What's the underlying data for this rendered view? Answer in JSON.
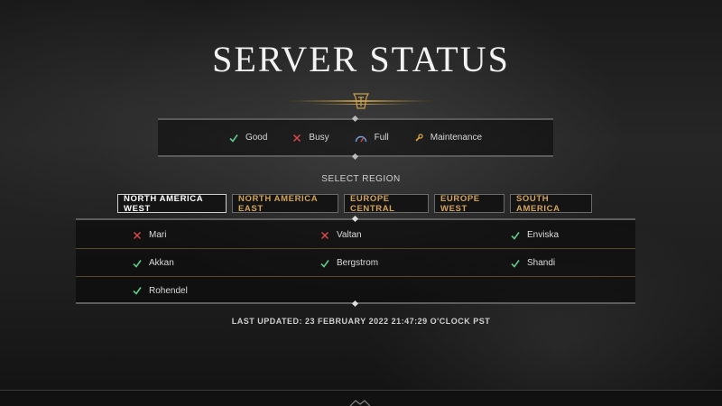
{
  "page": {
    "title": "SERVER STATUS",
    "select_region_label": "SELECT REGION",
    "last_updated": "LAST UPDATED: 23 FEBRUARY 2022 21:47:29 O'CLOCK PST"
  },
  "legend": [
    {
      "icon": "check-icon",
      "label": "Good"
    },
    {
      "icon": "x-icon",
      "label": "Busy"
    },
    {
      "icon": "gauge-icon",
      "label": "Full"
    },
    {
      "icon": "wrench-icon",
      "label": "Maintenance"
    }
  ],
  "tabs": [
    {
      "label": "NORTH AMERICA WEST",
      "active": true
    },
    {
      "label": "NORTH AMERICA EAST",
      "active": false
    },
    {
      "label": "EUROPE CENTRAL",
      "active": false
    },
    {
      "label": "EUROPE WEST",
      "active": false
    },
    {
      "label": "SOUTH AMERICA",
      "active": false
    }
  ],
  "servers": [
    {
      "name": "Mari",
      "status": "busy"
    },
    {
      "name": "Valtan",
      "status": "busy"
    },
    {
      "name": "Enviska",
      "status": "good"
    },
    {
      "name": "Akkan",
      "status": "good"
    },
    {
      "name": "Bergstrom",
      "status": "good"
    },
    {
      "name": "Shandi",
      "status": "good"
    },
    {
      "name": "Rohendel",
      "status": "good"
    }
  ],
  "colors": {
    "good": "#5fc98a",
    "busy": "#d94848",
    "full": "#6fa0d8",
    "maintenance": "#d9a43c",
    "tab_text": "#d3a35a"
  }
}
